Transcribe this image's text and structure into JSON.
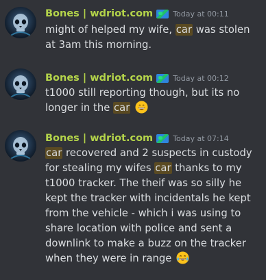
{
  "messages": [
    {
      "username": "Bones | wdriot.com",
      "timestamp": "Today at 00:11",
      "parts": [
        {
          "text": "might of helped my wife, "
        },
        {
          "text": "car",
          "highlight": true
        },
        {
          "text": " was stolen at 3am this morning."
        }
      ]
    },
    {
      "username": "Bones | wdriot.com",
      "timestamp": "Today at 00:12",
      "parts": [
        {
          "text": "t1000 still reporting though, but its no longer in the "
        },
        {
          "text": "car",
          "highlight": true
        },
        {
          "text": " "
        }
      ],
      "emoji": "grinning-emoji"
    },
    {
      "username": "Bones | wdriot.com",
      "timestamp": "Today at 07:14",
      "parts": [
        {
          "text": "car",
          "highlight": true
        },
        {
          "text": " recovered and 2 suspects in custody for stealing my wifes "
        },
        {
          "text": "car",
          "highlight": true
        },
        {
          "text": " thanks to my t1000 tracker. The theif was so silly he kept the tracker with incidentals he kept from the vehicle - which i was using to share location with police and sent a downlink to make a buzz on the tracker when they were in range "
        }
      ],
      "emoji": "tears-of-joy-emoji"
    }
  ],
  "colors": {
    "background": "#313338",
    "username": "#b4d44a",
    "timestamp": "#949ba4",
    "text": "#dbdee1",
    "highlight": "#5a4a22"
  },
  "icons": {
    "role_badge": "world-map-icon",
    "avatar": "skull-avatar"
  }
}
